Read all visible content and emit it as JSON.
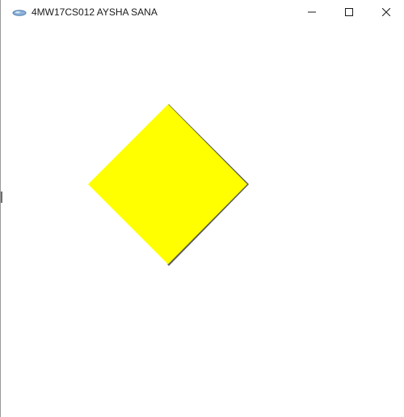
{
  "window": {
    "title": "4MW17CS012 AYSHA SANA",
    "app_icon": "opengl-app-icon",
    "controls": {
      "minimize_icon": "minimize-icon",
      "maximize_icon": "maximize-icon",
      "close_icon": "close-icon"
    }
  },
  "canvas": {
    "background_color": "#ffffff",
    "shape": {
      "kind": "diamond",
      "fill_color": "#ffff00",
      "edge_color": "#5a5a5a"
    }
  }
}
